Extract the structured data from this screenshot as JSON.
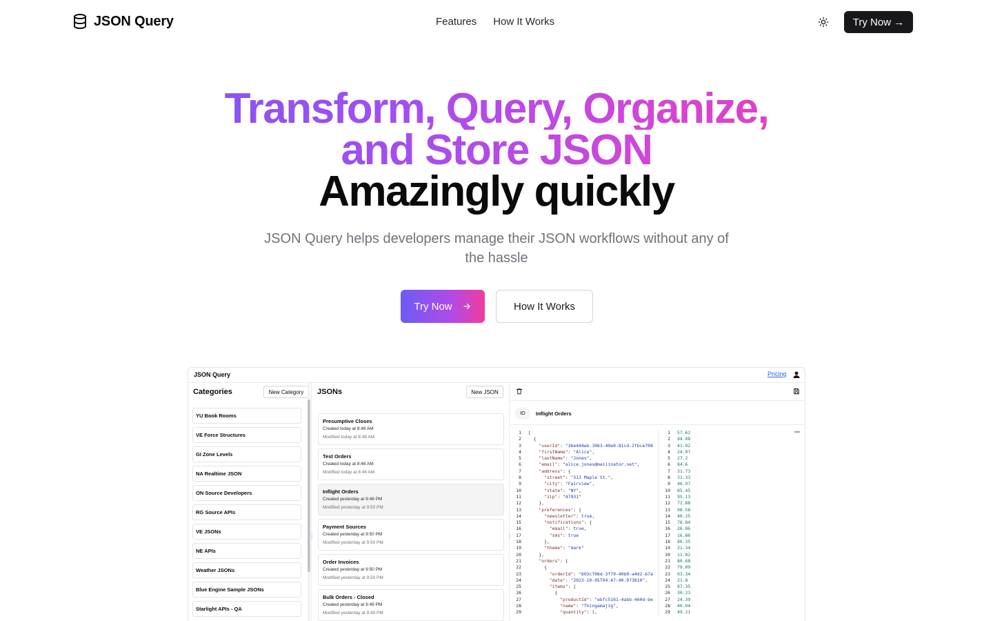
{
  "nav": {
    "brand": "JSON Query",
    "links": [
      "Features",
      "How It Works"
    ],
    "cta": "Try Now →"
  },
  "hero": {
    "title_line1": "Transform, Query, Organize,",
    "title_line2": "and Store JSON",
    "title_line3": "Amazingly quickly",
    "subtitle": "JSON Query helps developers manage their JSON workflows without any of the hassle",
    "primary_button": "Try Now",
    "secondary_button": "How It Works"
  },
  "colors": {
    "gradient_start": "#6d5cf6",
    "gradient_end": "#f23c9b",
    "cta_dark": "#18181b"
  },
  "preview": {
    "app_title": "JSON Query",
    "pricing_link": "Pricing",
    "categories": {
      "title": "Categories",
      "new_button": "New Category",
      "items": [
        "YU Book Rooms",
        "VE Force Structures",
        "GI Zone Levels",
        "NA Realtime JSON",
        "ON Source Developers",
        "RG Source APIs",
        "VE JSONs",
        "NE APIs",
        "Weather JSONs",
        "Blue Engine Sample JSONs",
        "Starlight APIs - QA"
      ]
    },
    "jsons": {
      "title": "JSONs",
      "new_button": "New JSON",
      "items": [
        {
          "name": "Presumptive Closes",
          "created": "Created today at 8:48 AM",
          "modified": "Modified today at 8:48 AM",
          "active": false
        },
        {
          "name": "Test Orders",
          "created": "Created today at 8:48 AM",
          "modified": "Modified today at 8:48 AM",
          "active": false
        },
        {
          "name": "Inflight Orders",
          "created": "Created yesterday at 9:49 PM",
          "modified": "Modified yesterday at 9:50 PM",
          "active": true
        },
        {
          "name": "Payment Sources",
          "created": "Created yesterday at 9:50 PM",
          "modified": "Modified yesterday at 9:50 PM",
          "active": false
        },
        {
          "name": "Order Invoices",
          "created": "Created yesterday at 9:50 PM",
          "modified": "Modified yesterday at 9:50 PM",
          "active": false
        },
        {
          "name": "Bulk Orders - Closed",
          "created": "Created yesterday at 9:49 PM",
          "modified": "Modified yesterday at 9:49 PM",
          "active": false
        }
      ]
    },
    "editor": {
      "io_label": "IO",
      "json_name": "Inflight Orders",
      "left_lines": [
        [
          [
            "p",
            "["
          ]
        ],
        [
          [
            "p",
            "  {"
          ]
        ],
        [
          [
            "p",
            "    "
          ],
          [
            "k",
            "\"userId\""
          ],
          [
            "p",
            ": "
          ],
          [
            "s",
            "\"3be444eb-3063-49e0-81cd-2fbce708"
          ]
        ],
        [
          [
            "p",
            "    "
          ],
          [
            "k",
            "\"firstName\""
          ],
          [
            "p",
            ": "
          ],
          [
            "s",
            "\"Alice\""
          ],
          [
            "p",
            ","
          ]
        ],
        [
          [
            "p",
            "    "
          ],
          [
            "k",
            "\"lastName\""
          ],
          [
            "p",
            ": "
          ],
          [
            "s",
            "\"Jones\""
          ],
          [
            "p",
            ","
          ]
        ],
        [
          [
            "p",
            "    "
          ],
          [
            "k",
            "\"email\""
          ],
          [
            "p",
            ": "
          ],
          [
            "s",
            "\"alice.jones@mailinator.net\""
          ],
          [
            "p",
            ","
          ]
        ],
        [
          [
            "p",
            "    "
          ],
          [
            "k",
            "\"address\""
          ],
          [
            "p",
            ": {"
          ]
        ],
        [
          [
            "p",
            "      "
          ],
          [
            "k",
            "\"street\""
          ],
          [
            "p",
            ": "
          ],
          [
            "s",
            "\"313 Maple St.\""
          ],
          [
            "p",
            ","
          ]
        ],
        [
          [
            "p",
            "      "
          ],
          [
            "k",
            "\"city\""
          ],
          [
            "p",
            ": "
          ],
          [
            "s",
            "\"Fairview\""
          ],
          [
            "p",
            ","
          ]
        ],
        [
          [
            "p",
            "      "
          ],
          [
            "k",
            "\"state\""
          ],
          [
            "p",
            ": "
          ],
          [
            "s",
            "\"NY\""
          ],
          [
            "p",
            ","
          ]
        ],
        [
          [
            "p",
            "      "
          ],
          [
            "k",
            "\"zip\""
          ],
          [
            "p",
            ": "
          ],
          [
            "s",
            "\"47931\""
          ]
        ],
        [
          [
            "p",
            "    },"
          ]
        ],
        [
          [
            "p",
            "    "
          ],
          [
            "k",
            "\"preferences\""
          ],
          [
            "p",
            ": {"
          ]
        ],
        [
          [
            "p",
            "      "
          ],
          [
            "k",
            "\"newsletter\""
          ],
          [
            "p",
            ": "
          ],
          [
            "b",
            "true"
          ],
          [
            "p",
            ","
          ]
        ],
        [
          [
            "p",
            "      "
          ],
          [
            "k",
            "\"notifications\""
          ],
          [
            "p",
            ": {"
          ]
        ],
        [
          [
            "p",
            "        "
          ],
          [
            "k",
            "\"email\""
          ],
          [
            "p",
            ": "
          ],
          [
            "b",
            "true"
          ],
          [
            "p",
            ","
          ]
        ],
        [
          [
            "p",
            "        "
          ],
          [
            "k",
            "\"sms\""
          ],
          [
            "p",
            ": "
          ],
          [
            "b",
            "true"
          ]
        ],
        [
          [
            "p",
            "      },"
          ]
        ],
        [
          [
            "p",
            "      "
          ],
          [
            "k",
            "\"theme\""
          ],
          [
            "p",
            ": "
          ],
          [
            "s",
            "\"dark\""
          ]
        ],
        [
          [
            "p",
            "    },"
          ]
        ],
        [
          [
            "p",
            "    "
          ],
          [
            "k",
            "\"orders\""
          ],
          [
            "p",
            ": ["
          ]
        ],
        [
          [
            "p",
            "      {"
          ]
        ],
        [
          [
            "p",
            "        "
          ],
          [
            "k",
            "\"orderId\""
          ],
          [
            "p",
            ": "
          ],
          [
            "s",
            "\"603cf06d-3f79-40b0-a4d2-b7a"
          ]
        ],
        [
          [
            "p",
            "        "
          ],
          [
            "k",
            "\"date\""
          ],
          [
            "p",
            ": "
          ],
          [
            "s",
            "\"2023-10-05T04:47:40.073810\""
          ],
          [
            "p",
            ","
          ]
        ],
        [
          [
            "p",
            "        "
          ],
          [
            "k",
            "\"items\""
          ],
          [
            "p",
            ": ["
          ]
        ],
        [
          [
            "p",
            "          {"
          ]
        ],
        [
          [
            "p",
            "            "
          ],
          [
            "k",
            "\"productId\""
          ],
          [
            "p",
            ": "
          ],
          [
            "s",
            "\"ebfc5161-4abb-460d-be"
          ]
        ],
        [
          [
            "p",
            "            "
          ],
          [
            "k",
            "\"name\""
          ],
          [
            "p",
            ": "
          ],
          [
            "s",
            "\"Thingamajig\""
          ],
          [
            "p",
            ","
          ]
        ],
        [
          [
            "p",
            "            "
          ],
          [
            "k",
            "\"quantity\""
          ],
          [
            "p",
            ": "
          ],
          [
            "n",
            "1"
          ],
          [
            "p",
            ","
          ]
        ]
      ],
      "right_values": [
        "57.62",
        "94.08",
        "41.92",
        "24.97",
        "27.2",
        "84.6",
        "31.73",
        "31.33",
        "46.97",
        "85.45",
        "95.13",
        "72.88",
        "98.58",
        "40.25",
        "76.84",
        "26.86",
        "16.86",
        "86.35",
        "21.34",
        "11.82",
        "80.68",
        "79.09",
        "93.34",
        "21.8",
        "87.35",
        "30.23",
        "24.39",
        "40.94",
        "49.21"
      ]
    }
  }
}
